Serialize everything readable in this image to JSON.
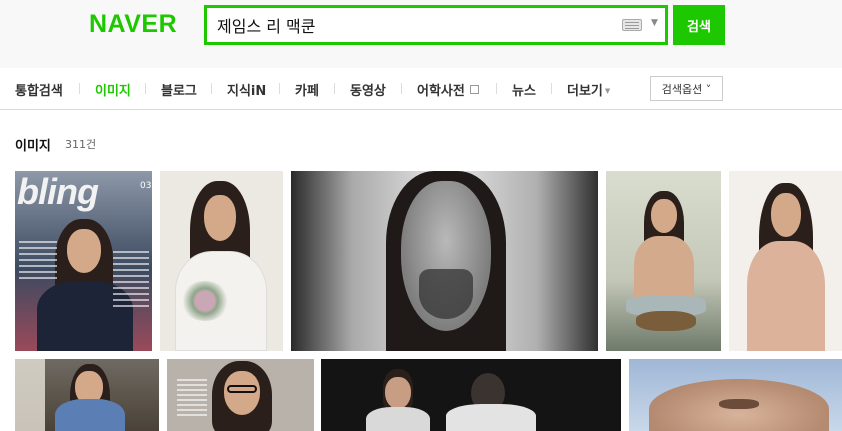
{
  "header": {
    "logo": "NAVER",
    "search_value": "제임스 리 맥쿤",
    "search_button": "검색"
  },
  "icons": {
    "keyboard": "keyboard-icon",
    "dropdown": "chevron-down-icon",
    "dictionary": "square-icon",
    "more": "caret-down-icon"
  },
  "nav": {
    "items": [
      "통합검색",
      "이미지",
      "블로그",
      "지식iN",
      "카페",
      "동영상",
      "어학사전",
      "뉴스",
      "더보기"
    ],
    "active_index": 1,
    "options_label": "검색옵션 ˅"
  },
  "results": {
    "section_title": "이미지",
    "count": "311건"
  },
  "thumbnails": [
    {
      "label": "bling",
      "caption": "03"
    },
    {
      "label": ""
    },
    {
      "label": ""
    },
    {
      "label": ""
    },
    {
      "label": ""
    },
    {
      "label": ""
    },
    {
      "label": ""
    },
    {
      "label": ""
    },
    {
      "label": ""
    }
  ],
  "colors": {
    "accent": "#1ec800",
    "header_bg": "#f8f8f8"
  }
}
